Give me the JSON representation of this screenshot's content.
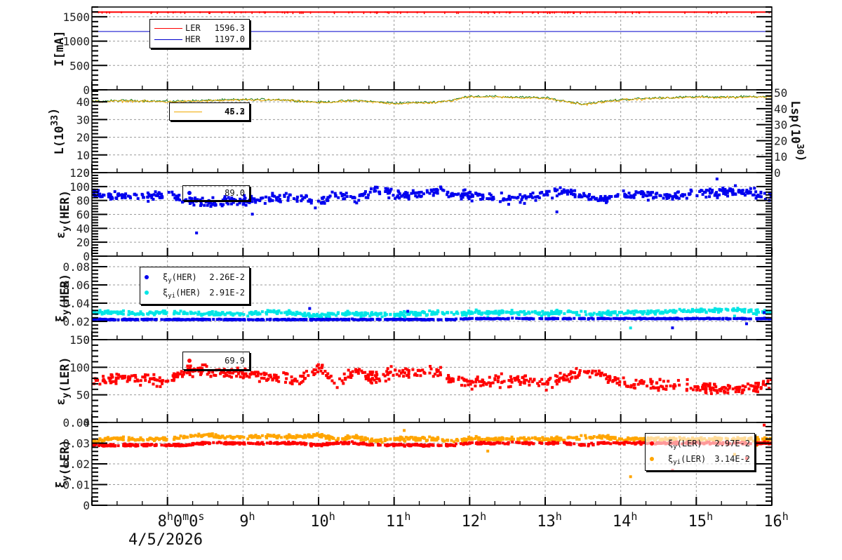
{
  "x_axis": {
    "hour_labels": [
      "9",
      "10",
      "11",
      "12",
      "13",
      "14",
      "15",
      "16"
    ],
    "first_label": {
      "h": "8",
      "m": "0",
      "s": "0"
    },
    "unit_h": "h",
    "unit_m": "m",
    "unit_s": "s",
    "date": "4/5/2026",
    "range_hours": [
      7,
      16
    ]
  },
  "legends": {
    "current": [
      {
        "name": "LER",
        "value": "1596.3",
        "color": "#ff0000"
      },
      {
        "name": "HER",
        "value": "1197.0",
        "color": "#0000cc"
      }
    ],
    "lumi": {
      "values": [
        "45.2",
        "46.3"
      ],
      "color": "#f0a800"
    },
    "eps_her": {
      "value": "89.0",
      "color": "#0000ee"
    },
    "xi_her": [
      {
        "name": "ξ",
        "sub": "y",
        "rest": "(HER)",
        "value": "2.26E-2",
        "color": "#0000ee"
      },
      {
        "name": "ξ",
        "sub": "yi",
        "rest": "(HER)",
        "value": "2.91E-2",
        "color": "#00e5e5"
      }
    ],
    "eps_ler": {
      "value": "69.9",
      "color": "#ff0000"
    },
    "xi_ler": [
      {
        "name": "ξ",
        "sub": "y",
        "rest": "(LER)",
        "value": "2.97E-2",
        "color": "#ff0000"
      },
      {
        "name": "ξ",
        "sub": "yi",
        "rest": "(LER)",
        "value": "3.14E-2",
        "color": "#ffa500"
      }
    ]
  },
  "chart_data": [
    {
      "type": "line",
      "id": "current",
      "ylabel": [
        [
          "I[mA]",
          ""
        ]
      ],
      "ylim": [
        0,
        1700
      ],
      "yticks": [
        0,
        500,
        1000,
        1500
      ],
      "x_hours": [
        7,
        16
      ],
      "series": [
        {
          "name": "LER",
          "color": "#ff0000",
          "values": [
            1596.3,
            1596.3
          ]
        },
        {
          "name": "HER",
          "color": "#0000cc",
          "values": [
            1197,
            1197
          ]
        }
      ]
    },
    {
      "type": "line",
      "id": "lumi",
      "ylabel": [
        [
          "L(10",
          ""
        ],
        [
          "33",
          "sup"
        ],
        [
          ")",
          ""
        ]
      ],
      "ylim": [
        0,
        46.8
      ],
      "yticks": [
        0,
        10,
        20,
        30,
        40
      ],
      "y2label": [
        [
          "Lsp(10",
          ""
        ],
        [
          "30",
          "sup"
        ],
        [
          ")",
          ""
        ]
      ],
      "y2lim": [
        0,
        51.8
      ],
      "y2ticks": [
        0,
        10,
        20,
        30,
        40,
        50
      ],
      "x": [
        7,
        7.5,
        8,
        8.5,
        9,
        9.5,
        10,
        10.5,
        11,
        11.5,
        11.75,
        12,
        12.5,
        13,
        13.5,
        14,
        14.5,
        15,
        15.5,
        16
      ],
      "series": [
        {
          "name": "L",
          "color": "#f0a800",
          "values": [
            40,
            40.5,
            40,
            40.5,
            41,
            41,
            39.5,
            40.5,
            39,
            39.5,
            40.5,
            43,
            42.5,
            42,
            38.5,
            41,
            42,
            42.5,
            42.5,
            43
          ]
        },
        {
          "name": "Lsp",
          "color": "#1a7a1a",
          "values": [
            40.2,
            40.7,
            40.2,
            40.7,
            41.2,
            41.2,
            39.7,
            40.7,
            39.2,
            39.7,
            40.7,
            43.2,
            42.7,
            42.2,
            38.7,
            41.2,
            42.2,
            42.7,
            42.7,
            43.2
          ]
        }
      ]
    },
    {
      "type": "scatter",
      "id": "eps_her",
      "ylabel": [
        [
          "ε",
          ""
        ],
        [
          "y",
          "sub"
        ],
        [
          "(HER)",
          ""
        ]
      ],
      "ylim": [
        0,
        120
      ],
      "yticks": [
        0,
        20,
        40,
        60,
        80,
        100,
        120
      ],
      "x_step_hours": 0.25,
      "series": [
        {
          "name": "εy(HER)",
          "color": "#0000ee",
          "noise": 5,
          "values": [
            90,
            87,
            86,
            86,
            88,
            79,
            77,
            80,
            80,
            82,
            84,
            85,
            76,
            90,
            82,
            95,
            88,
            86,
            94,
            90,
            87,
            85,
            83,
            83,
            90,
            92,
            86,
            82,
            88,
            89,
            88,
            87,
            90,
            92,
            94,
            90,
            86
          ]
        }
      ]
    },
    {
      "type": "scatter",
      "id": "xi_her",
      "ylabel": [
        [
          "ξ",
          ""
        ],
        [
          "y",
          "sub"
        ],
        [
          "(HER)",
          ""
        ]
      ],
      "ylim": [
        0,
        0.0915
      ],
      "yticks": [
        0,
        0.02,
        0.04,
        0.06,
        0.08
      ],
      "ytick_labels": [
        "0",
        "0.02",
        "0.04",
        "0.06",
        "0.08"
      ],
      "x_step_hours": 0.25,
      "series": [
        {
          "name": "ξyi(HER)",
          "color": "#00e5e5",
          "noise": 0.0018,
          "values": [
            0.031,
            0.029,
            0.029,
            0.029,
            0.03,
            0.029,
            0.028,
            0.029,
            0.028,
            0.029,
            0.03,
            0.028,
            0.026,
            0.029,
            0.028,
            0.028,
            0.027,
            0.028,
            0.029,
            0.029,
            0.029,
            0.03,
            0.03,
            0.029,
            0.029,
            0.03,
            0.029,
            0.028,
            0.03,
            0.03,
            0.03,
            0.031,
            0.032,
            0.032,
            0.033,
            0.031,
            0.03
          ]
        },
        {
          "name": "ξy(HER)",
          "color": "#0000ee",
          "noise": 0.0004,
          "values": [
            0.022,
            0.022,
            0.022,
            0.022,
            0.022,
            0.022,
            0.022,
            0.022,
            0.022,
            0.022,
            0.022,
            0.022,
            0.022,
            0.022,
            0.022,
            0.022,
            0.022,
            0.022,
            0.022,
            0.022,
            0.023,
            0.023,
            0.023,
            0.023,
            0.023,
            0.023,
            0.023,
            0.023,
            0.023,
            0.023,
            0.023,
            0.023,
            0.023,
            0.023,
            0.023,
            0.023,
            0.023
          ]
        }
      ]
    },
    {
      "type": "scatter",
      "id": "eps_ler",
      "ylabel": [
        [
          "ε",
          ""
        ],
        [
          "y",
          "sub"
        ],
        [
          "(LER)",
          ""
        ]
      ],
      "ylim": [
        0,
        150
      ],
      "yticks": [
        0,
        50,
        100,
        150
      ],
      "x_step_hours": 0.25,
      "series": [
        {
          "name": "εy(LER)",
          "color": "#ff0000",
          "noise": 8,
          "values": [
            70,
            80,
            82,
            78,
            75,
            92,
            95,
            90,
            90,
            85,
            80,
            78,
            100,
            72,
            95,
            78,
            92,
            88,
            95,
            80,
            72,
            74,
            78,
            78,
            72,
            80,
            90,
            88,
            72,
            70,
            68,
            68,
            65,
            62,
            60,
            65,
            72
          ]
        }
      ]
    },
    {
      "type": "scatter",
      "id": "xi_ler",
      "ylabel": [
        [
          "ξ",
          ""
        ],
        [
          "y",
          "sub"
        ],
        [
          "(LER)",
          ""
        ]
      ],
      "ylim": [
        0,
        0.04
      ],
      "yticks": [
        0,
        0.01,
        0.02,
        0.03,
        0.04
      ],
      "ytick_labels": [
        "0",
        "0.01",
        "0.02",
        "0.03",
        "0.04"
      ],
      "x_step_hours": 0.25,
      "series": [
        {
          "name": "ξyi(LER)",
          "color": "#ffa500",
          "noise": 0.0007,
          "values": [
            0.031,
            0.032,
            0.032,
            0.032,
            0.032,
            0.033,
            0.034,
            0.033,
            0.033,
            0.033,
            0.033,
            0.033,
            0.034,
            0.032,
            0.033,
            0.031,
            0.032,
            0.032,
            0.032,
            0.031,
            0.032,
            0.032,
            0.032,
            0.032,
            0.032,
            0.032,
            0.033,
            0.033,
            0.032,
            0.032,
            0.032,
            0.032,
            0.032,
            0.032,
            0.032,
            0.032,
            0.032
          ]
        },
        {
          "name": "ξy(LER)",
          "color": "#ff0000",
          "noise": 0.0004,
          "values": [
            0.029,
            0.029,
            0.029,
            0.029,
            0.029,
            0.029,
            0.03,
            0.03,
            0.03,
            0.03,
            0.03,
            0.03,
            0.029,
            0.03,
            0.03,
            0.029,
            0.029,
            0.029,
            0.029,
            0.029,
            0.03,
            0.03,
            0.03,
            0.03,
            0.03,
            0.03,
            0.029,
            0.03,
            0.03,
            0.03,
            0.03,
            0.03,
            0.03,
            0.03,
            0.03,
            0.03,
            0.03
          ]
        }
      ]
    }
  ]
}
